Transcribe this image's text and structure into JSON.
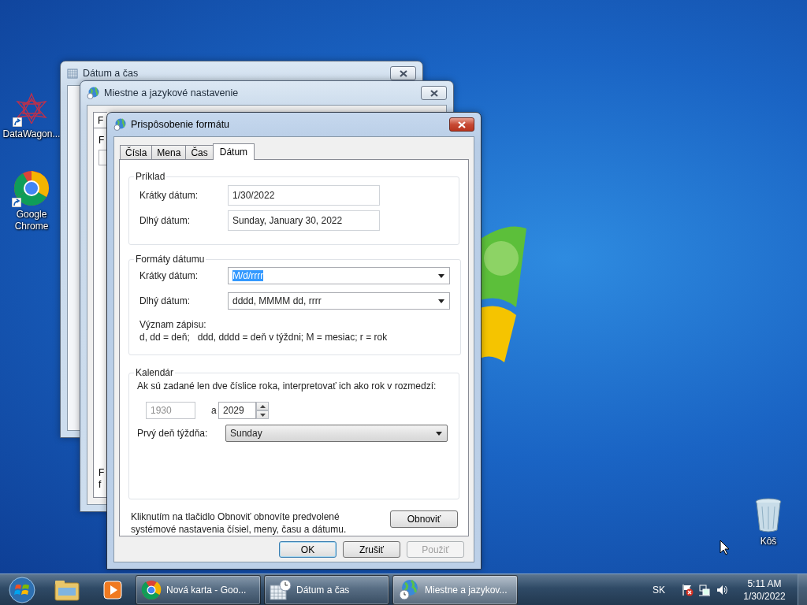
{
  "desktop_icons": [
    {
      "label": "DataWagon...",
      "kind": "app",
      "shortcut": true
    },
    {
      "label": "Google Chrome",
      "kind": "browser",
      "shortcut": true
    },
    {
      "label": "Kôš",
      "kind": "trash",
      "shortcut": false
    }
  ],
  "back_window": {
    "title": "Dátum a čas"
  },
  "middle_window": {
    "title": "Miestne a jazykové nastavenie",
    "tab": "F",
    "label_top": "F",
    "labels_bottom": [
      "F",
      "f"
    ]
  },
  "dialog": {
    "title": "Prispôsobenie formátu",
    "tabs": [
      {
        "label": "Čísla",
        "selected": false
      },
      {
        "label": "Mena",
        "selected": false
      },
      {
        "label": "Čas",
        "selected": false
      },
      {
        "label": "Dátum",
        "selected": true
      }
    ],
    "example": {
      "legend": "Príklad",
      "rows": [
        {
          "label": "Krátky dátum:",
          "value": "1/30/2022"
        },
        {
          "label": "Dlhý dátum:",
          "value": "Sunday, January 30, 2022"
        }
      ]
    },
    "formats": {
      "legend": "Formáty dátumu",
      "rows": [
        {
          "label": "Krátky dátum:",
          "value": "M/d/rrrr",
          "highlighted": true
        },
        {
          "label": "Dlhý dátum:",
          "value": "dddd, MMMM dd, rrrr",
          "highlighted": false
        }
      ],
      "notation_title": "Význam zápisu:",
      "notation": "d, dd = deň;   ddd, dddd = deň v týždni; M = mesiac; r = rok"
    },
    "calendar": {
      "legend": "Kalendár",
      "text": "Ak sú zadané len dve číslice roka, interpretovať ich ako rok v rozmedzí:",
      "from": {
        "value": "1930",
        "disabled": true
      },
      "between": "a",
      "to": {
        "value": "2029",
        "disabled": false
      },
      "first_day_label": "Prvý deň týždňa:",
      "first_day": "Sunday"
    },
    "reset_text": "Kliknutím na tlačidlo Obnoviť obnovíte predvolené systémové nastavenia čísiel, meny, času a dátumu.",
    "reset_button": "Obnoviť",
    "buttons": [
      {
        "label": "OK",
        "default": true,
        "disabled": false
      },
      {
        "label": "Zrušiť",
        "default": false,
        "disabled": false
      },
      {
        "label": "Použiť",
        "default": false,
        "disabled": true
      }
    ]
  },
  "taskbar": {
    "pinned": [
      {
        "kind": "explorer"
      },
      {
        "kind": "media"
      }
    ],
    "tasks": [
      {
        "label": "Nová karta - Goo...",
        "kind": "browser",
        "active": false
      },
      {
        "label": "Dátum a čas",
        "kind": "clock",
        "active": false
      },
      {
        "label": "Miestne a jazykov...",
        "kind": "globe",
        "active": true
      }
    ],
    "language": "SK",
    "time": "5:11 AM",
    "date": "1/30/2022"
  }
}
